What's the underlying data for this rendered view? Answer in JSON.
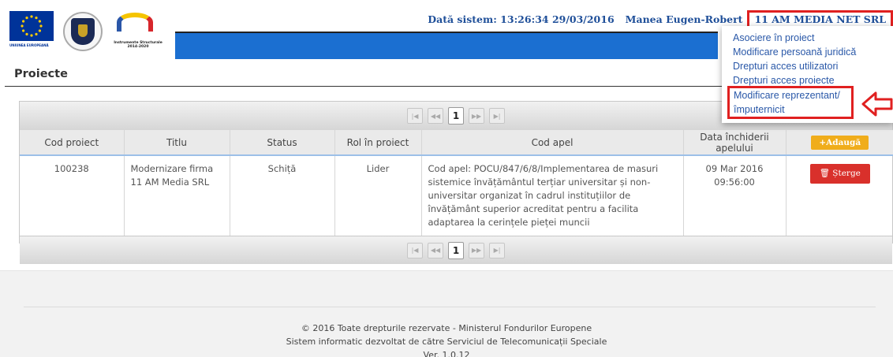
{
  "header": {
    "logo_eu_caption": "UNIUNEA EUROPEANĂ",
    "logo_is_caption": "Instrumente Structurale 2014-2020",
    "system_date": "Dată sistem: 13:26:34 29/03/2016",
    "user_name": "Manea Eugen-Robert",
    "organization": "11 AM MEDIA NET SRL"
  },
  "dropdown": {
    "items": [
      "Asociere în proiect",
      "Modificare persoană juridică",
      "Drepturi acces utilizatori",
      "Drepturi acces proiecte",
      "Modificare reprezentant/împuternicit"
    ]
  },
  "page": {
    "title": "Proiecte"
  },
  "pager": {
    "first": "|◀",
    "prev": "◀◀",
    "current": "1",
    "next": "▶▶",
    "last": "▶|"
  },
  "table": {
    "columns": [
      "Cod proiect",
      "Titlu",
      "Status",
      "Rol în proiect",
      "Cod apel",
      "Data închiderii apelului"
    ],
    "add_label": "+Adaugă",
    "rows": [
      {
        "cod": "100238",
        "titlu": "Modernizare firma 11 AM Media SRL",
        "status": "Schiță",
        "rol": "Lider",
        "cod_apel": "Cod apel: POCU/847/6/8/Implementarea de masuri sistemice învățământul terțiar universitar și non-universitar organizat în cadrul instituțiilor de învățământ superior acreditat pentru a facilita adaptarea la cerințele pieței muncii",
        "data": "09 Mar 2016 09:56:00",
        "delete_label": "🗑 Șterge"
      }
    ]
  },
  "footer": {
    "line1": "© 2016 Toate drepturile rezervate - Ministerul Fondurilor Europene",
    "line2": "Sistem informatic dezvoltat de către Serviciul de Telecomunicații Speciale",
    "line3": "Ver. 1.0.12"
  },
  "colors": {
    "accent_blue": "#1b6fd1",
    "link_blue": "#2a58a8",
    "highlight_red": "#e02020",
    "add_orange": "#f0ad1b",
    "delete_red": "#d9302b"
  }
}
